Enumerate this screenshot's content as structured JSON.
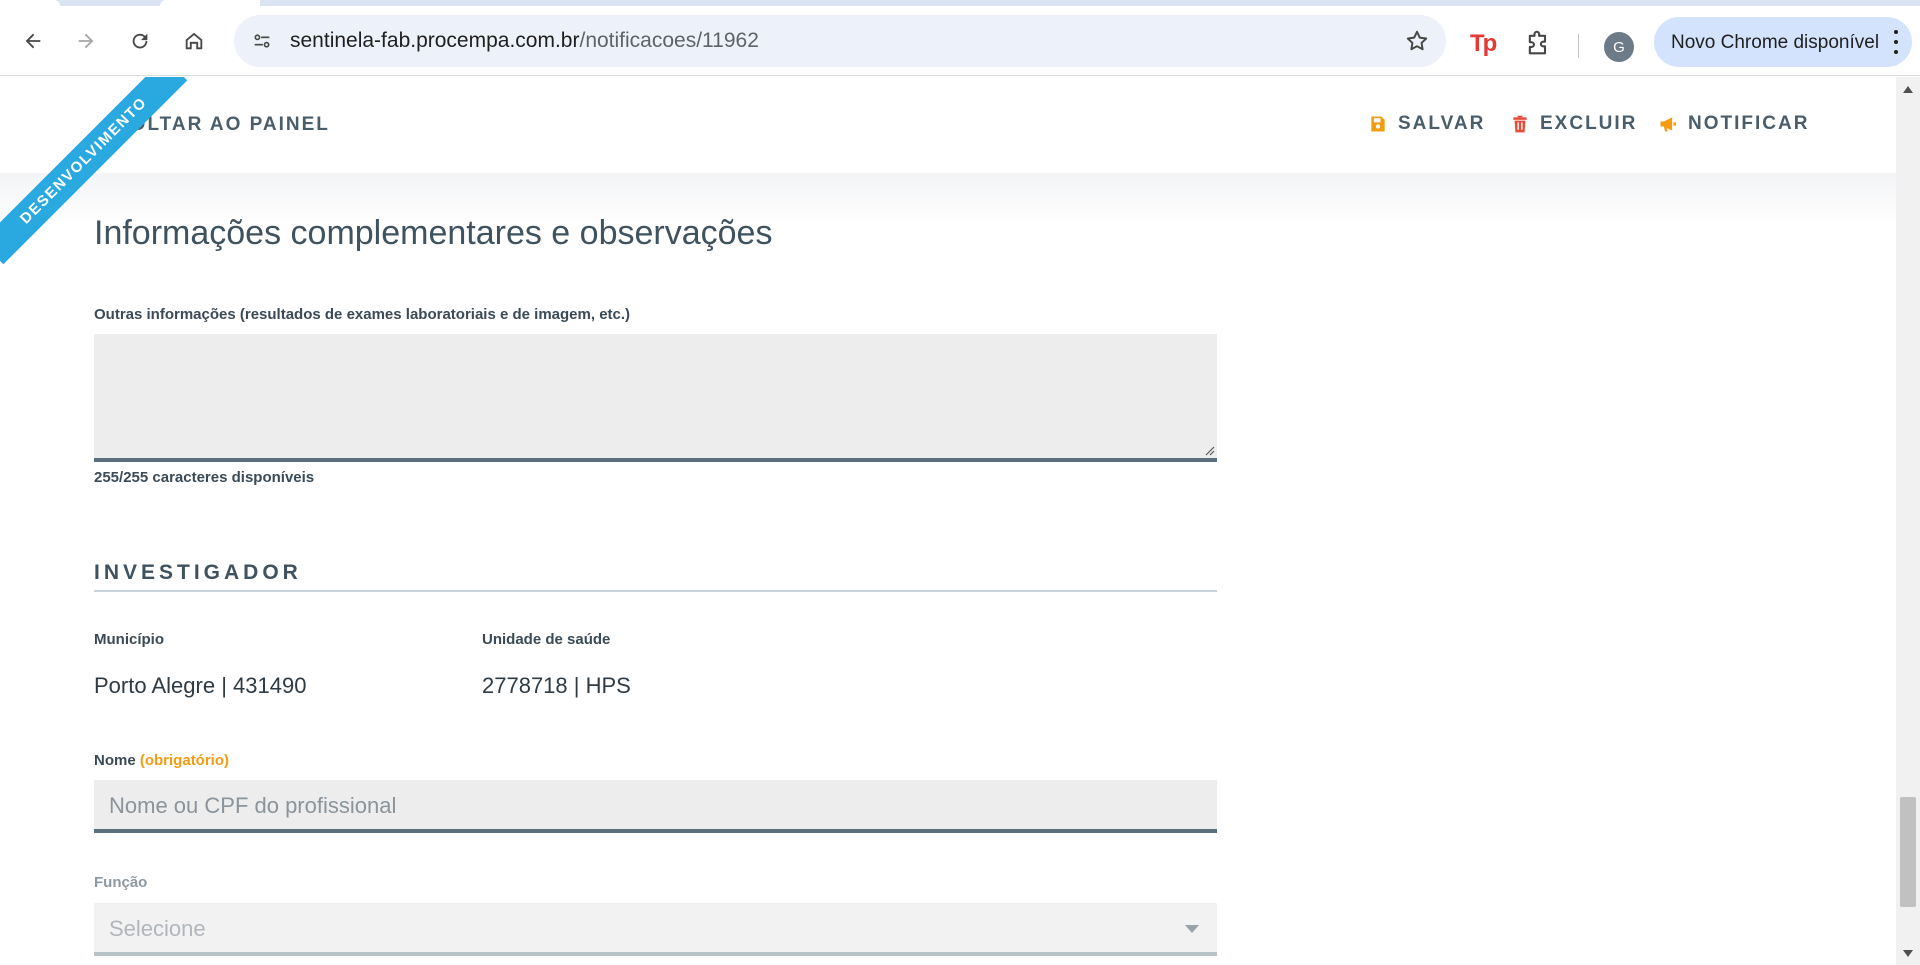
{
  "browser": {
    "url_host": "sentinela-fab.procempa.com.br",
    "url_path": "/notificacoes/11962",
    "extension_tp_label": "Tp",
    "profile_initial": "G",
    "update_label": "Novo Chrome disponível",
    "icons": [
      "back-arrow-icon",
      "forward-arrow-icon",
      "reload-icon",
      "home-icon",
      "site-info-icon",
      "bookmark-star-icon",
      "puzzle-extensions-icon",
      "kebab-menu-icon"
    ]
  },
  "toolbar": {
    "ribbon_label": "DESENVOLVIMENTO",
    "back_label": "VOLTAR AO PAINEL",
    "save_label": "SALVAR",
    "delete_label": "EXCLUIR",
    "notify_label": "NOTIFICAR",
    "save_color": "#f39c12",
    "delete_color": "#e74c3c",
    "notify_color": "#f39c12"
  },
  "section": {
    "title": "Informações complementares e observações",
    "other_info_label": "Outras informações (resultados de exames laboratoriais e de imagem, etc.)",
    "other_info_value": "",
    "chars_available": "255/255 caracteres disponíveis"
  },
  "investigador": {
    "heading": "INVESTIGADOR",
    "municipio_label": "Município",
    "municipio_value": "Porto Alegre | 431490",
    "unidade_label": "Unidade de saúde",
    "unidade_value": "2778718 | HPS",
    "nome_label": "Nome",
    "nome_required": "(obrigatório)",
    "nome_placeholder": "Nome ou CPF do profissional",
    "funcao_label": "Função",
    "funcao_selected": "Selecione"
  }
}
